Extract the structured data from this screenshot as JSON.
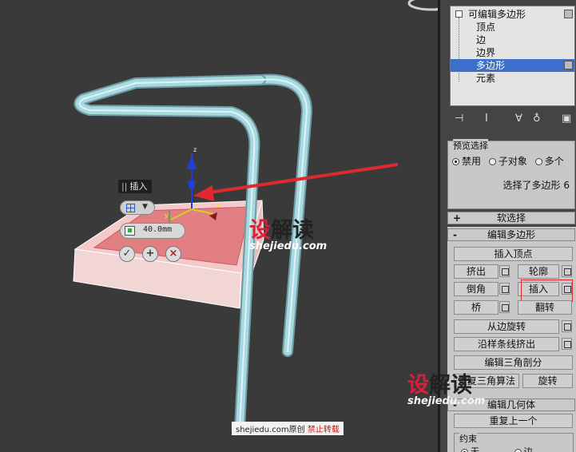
{
  "stack": {
    "title": "可编辑多边形",
    "items": [
      "顶点",
      "边",
      "边界",
      "多边形",
      "元素"
    ],
    "selected": "多边形"
  },
  "toolbar_icons": [
    "pin-stack-icon",
    "show-end-result-icon",
    "make-unique-icon",
    "remove-modifier-icon",
    "configure-sets-icon"
  ],
  "preview": {
    "title": "预览选择",
    "options": [
      "禁用",
      "子对象",
      "多个"
    ],
    "selected": "禁用",
    "status": "选择了多边形 6"
  },
  "soft_selection": {
    "label": "软选择",
    "toggle": "+"
  },
  "edit_polygons": {
    "label": "编辑多边形",
    "toggle": "-",
    "insert_vertex": "插入顶点",
    "extrude": "挤出",
    "outline": "轮廓",
    "bevel": "倒角",
    "inset": "插入",
    "bridge": "桥",
    "flip": "翻转",
    "hinge": "从边旋转",
    "extrude_spline": "沿样条线挤出",
    "edit_tri": "编辑三角剖分",
    "retriangulate": "重复三角算法",
    "turn": "旋转"
  },
  "edit_geometry": {
    "label": "编辑几何体",
    "repeat_last": "重复上一个",
    "constraints_label": "约束",
    "constraint_none": "无",
    "constraint_edge": "边"
  },
  "caddy": {
    "title": "插入",
    "amount": "40.0mm",
    "buttons": [
      "ok",
      "apply-continue",
      "cancel"
    ]
  },
  "gizmo": {
    "z": "z",
    "x": "x",
    "y": "y"
  },
  "watermarks": {
    "brand": "设解读",
    "url": "shejiedu.com",
    "footer_site": "shejiedu.com原创",
    "footer_warn": "禁止转载"
  },
  "colors": {
    "selection": "#3c6fc9",
    "highlight_box": "#e0282f",
    "arrow": "#e0282f",
    "chair_frame": "#9fd4dc",
    "seat_top": "#e88d8d"
  }
}
